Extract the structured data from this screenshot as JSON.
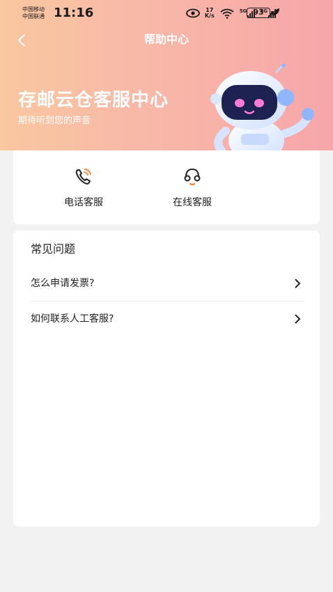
{
  "status_bar": {
    "carrier_1": "中国移动",
    "carrier_2": "中国联通",
    "time": "11:16",
    "speed_value": "17",
    "speed_unit": "K/s",
    "signal_1_label": "5G",
    "signal_2_label": "5G",
    "battery": "93"
  },
  "nav": {
    "title": "帮助中心"
  },
  "hero": {
    "title": "存邮云仓客服中心",
    "subtitle": "期待听到您的声音"
  },
  "services": [
    {
      "label": "电话客服",
      "icon": "phone-icon"
    },
    {
      "label": "在线客服",
      "icon": "headset-icon"
    }
  ],
  "faq": {
    "title": "常见问题",
    "items": [
      {
        "question": "怎么申请发票?"
      },
      {
        "question": "如何联系人工客服?"
      }
    ]
  },
  "colors": {
    "hero_gradient_start": "#f9c7a0",
    "hero_gradient_end": "#f7a6a9",
    "accent": "#ef8a3c",
    "background": "#f2f2f2"
  }
}
